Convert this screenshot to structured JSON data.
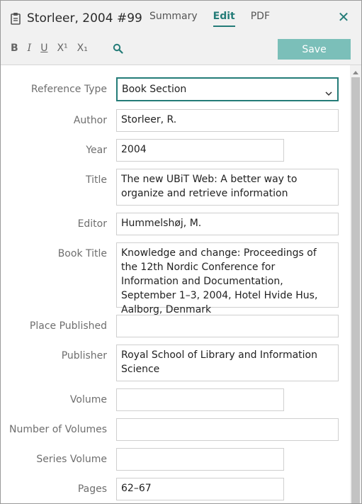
{
  "header": {
    "title": "Storleer, 2004 #99",
    "tabs": [
      "Summary",
      "Edit",
      "PDF"
    ],
    "active_tab": "Edit",
    "close_glyph": "✕"
  },
  "toolbar": {
    "bold": "B",
    "italic": "I",
    "underline": "U",
    "superscript": "X¹",
    "subscript": "X₁",
    "search_icon": "search-icon",
    "save_label": "Save"
  },
  "colors": {
    "accent": "#247c78",
    "save_button": "#7bbfb9",
    "header_bg": "#f1f1f1",
    "label": "#6e6e6e"
  },
  "fields": [
    {
      "label": "Reference Type",
      "value": "Book Section",
      "type": "select"
    },
    {
      "label": "Author",
      "value": "Storleer, R."
    },
    {
      "label": "Year",
      "value": "2004"
    },
    {
      "label": "Title",
      "value": "The new UBiT Web: A better way to organize and retrieve information"
    },
    {
      "label": "Editor",
      "value": "Hummelshøj, M."
    },
    {
      "label": "Book Title",
      "value": "Knowledge and change: Proceedings of the 12th Nordic Conference for Information and Documentation, September 1–3, 2004, Hotel Hvide Hus, Aalborg, Denmark"
    },
    {
      "label": "Place Published",
      "value": ""
    },
    {
      "label": "Publisher",
      "value": "Royal School of Library and Information Science"
    },
    {
      "label": "Volume",
      "value": ""
    },
    {
      "label": "Number of Volumes",
      "value": ""
    },
    {
      "label": "Series Volume",
      "value": ""
    },
    {
      "label": "Pages",
      "value": "62–67"
    }
  ]
}
